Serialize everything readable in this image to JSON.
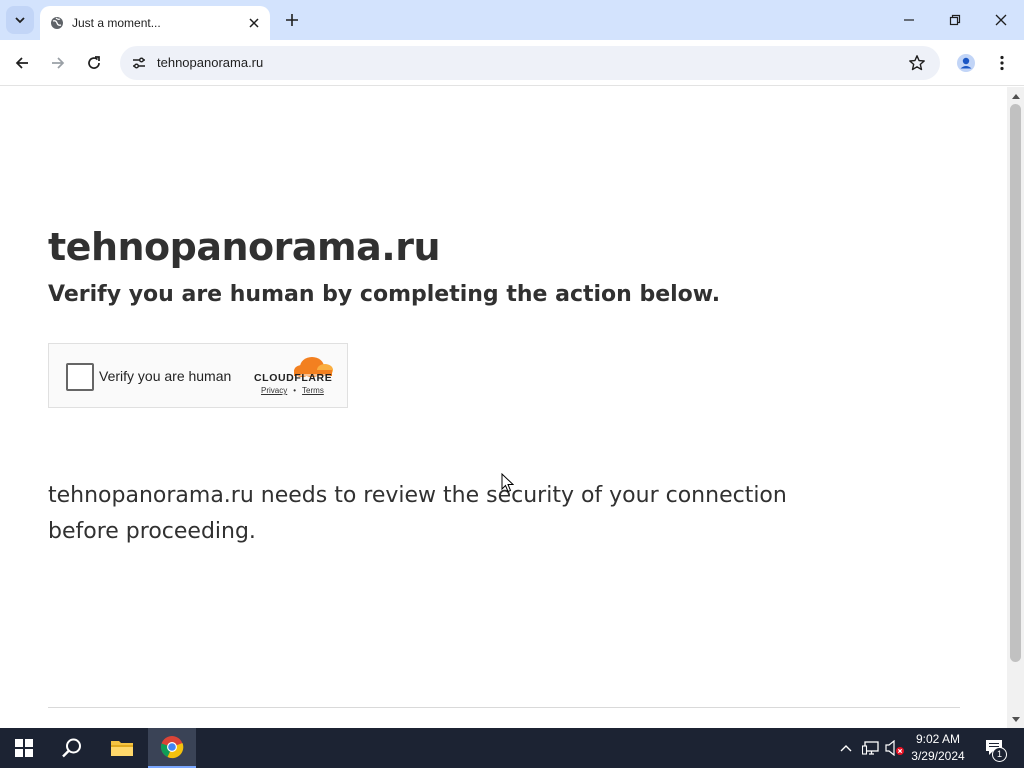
{
  "browser": {
    "tab": {
      "title": "Just a moment..."
    },
    "address": {
      "url": "tehnopanorama.ru"
    }
  },
  "page": {
    "heading": "tehnopanorama.ru",
    "subheading": "Verify you are human by completing the action below.",
    "challenge": {
      "checkbox_label": "Verify you are human",
      "brand": "CLOUDFLARE",
      "privacy_link": "Privacy",
      "separator": "•",
      "terms_link": "Terms"
    },
    "notice": "tehnopanorama.ru needs to review the security of your connection before proceeding."
  },
  "taskbar": {
    "time": "9:02 AM",
    "date": "3/29/2024",
    "notification_count": "1"
  },
  "colors": {
    "tabstrip_bg": "#d3e3fd",
    "taskbar_bg": "#1c2333",
    "cloudflare_orange": "#f38020",
    "text_dark": "#313131"
  },
  "icons": [
    "tab-search-icon",
    "globe-icon",
    "close-icon",
    "plus-icon",
    "minimize-icon",
    "restore-icon",
    "back-arrow-icon",
    "forward-arrow-icon",
    "reload-icon",
    "site-settings-icon",
    "star-icon",
    "profile-icon",
    "kebab-menu-icon",
    "windows-start-icon",
    "search-icon",
    "folder-icon",
    "chrome-icon",
    "chevron-up-icon",
    "network-icon",
    "volume-muted-icon",
    "notification-icon"
  ]
}
